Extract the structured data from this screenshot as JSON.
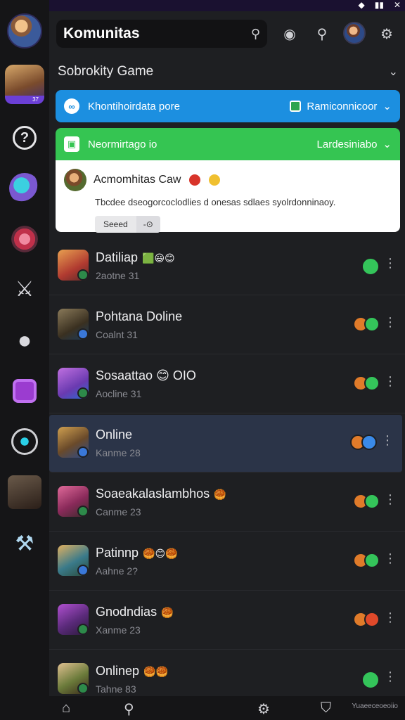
{
  "app": {
    "title": "Komunitas",
    "section": "Sobrokity Game",
    "status_icons": [
      "wifi-icon",
      "signal-icon",
      "close-icon"
    ]
  },
  "banners": {
    "blue": {
      "left_text": "Khontihoirdata pore",
      "right_text": "Ramiconnicoor"
    },
    "green": {
      "left_text": "Neormirtago io",
      "right_text": "Lardesiniabo"
    }
  },
  "notice": {
    "title": "Acmomhitas Caw",
    "body": "Tbcdee dseogorcoclodlies d onesas sdlaes syolrdonninaoy.",
    "action_primary": "Seeed",
    "action_secondary": "-⊙"
  },
  "rows": [
    {
      "name": "Datiliap",
      "emoji": "🟩😃😊",
      "sub": "2aotne 31",
      "status": "green",
      "icons": [
        "gr-big"
      ]
    },
    {
      "name": "Pohtana Doline",
      "emoji": "",
      "sub": "Coalnt 31",
      "status": "blue",
      "icons": [
        "or",
        "gr"
      ]
    },
    {
      "name": "Sosaattao 😊 OIO",
      "emoji": "",
      "sub": "Aocline 31",
      "status": "green",
      "icons": [
        "or",
        "gr"
      ]
    },
    {
      "name": "Online",
      "emoji": "",
      "sub": "Kanme 28",
      "status": "blue",
      "icons": [
        "or",
        "bl"
      ]
    },
    {
      "name": "Soaeakalaslambhos",
      "emoji": "🥮",
      "sub": "Canme 23",
      "status": "green",
      "icons": [
        "or",
        "gr"
      ]
    },
    {
      "name": "Patinnp",
      "emoji": "🥮😊🥮",
      "sub": "Aahne 2?",
      "status": "blue",
      "icons": [
        "or",
        "gr"
      ]
    },
    {
      "name": "Gnodndias",
      "emoji": "🥮",
      "sub": "Xanme 23",
      "status": "green",
      "icons": [
        "or",
        "rd"
      ]
    },
    {
      "name": "Onlinep",
      "emoji": "🥮🥮",
      "sub": "Tahne 83",
      "status": "green",
      "icons": [
        "gr-big"
      ]
    }
  ],
  "bottom": {
    "label": "Yuaeeceoeoiio"
  }
}
